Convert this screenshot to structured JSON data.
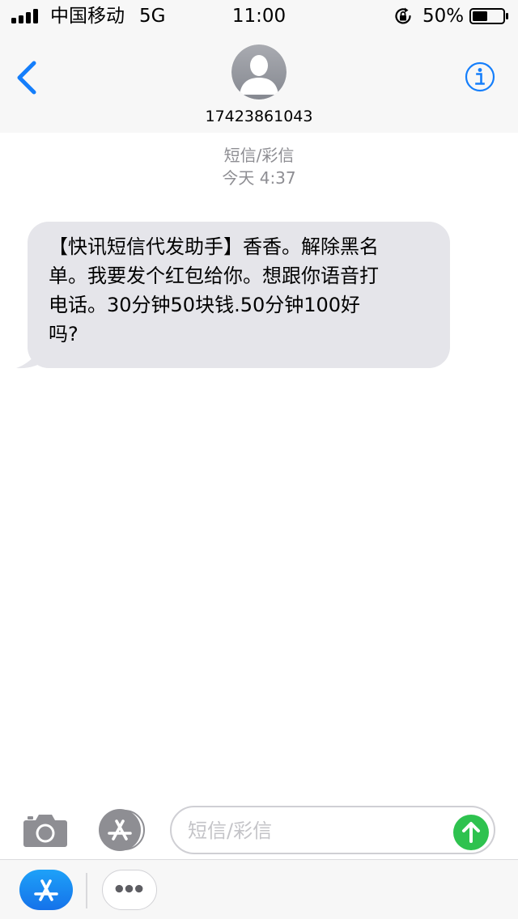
{
  "status_bar": {
    "carrier": "中国移动",
    "network": "5G",
    "time": "11:00",
    "battery_percent": "50%",
    "battery_level": 0.5
  },
  "header": {
    "back_icon": "chevron-left-icon",
    "avatar_icon": "person-silhouette-icon",
    "contact_number": "17423861043",
    "info_icon": "info-circle-icon"
  },
  "thread": {
    "service": "短信/彩信",
    "timestamp": "今天 4:37",
    "messages": [
      {
        "direction": "incoming",
        "lines": [
          "【快讯短信代发助手】香香。解除黑名",
          "单。我要发个红包给你。想跟你语音打",
          "电话。30分钟50块钱.50分钟100好",
          "吗?"
        ]
      }
    ]
  },
  "composer": {
    "placeholder": "短信/彩信",
    "value": ""
  },
  "colors": {
    "accent_blue": "#147efb",
    "bubble_gray": "#e5e5ea",
    "send_green": "#2ec24f",
    "meta_gray": "#8e8e93",
    "bar_bg": "#f7f7f7"
  }
}
